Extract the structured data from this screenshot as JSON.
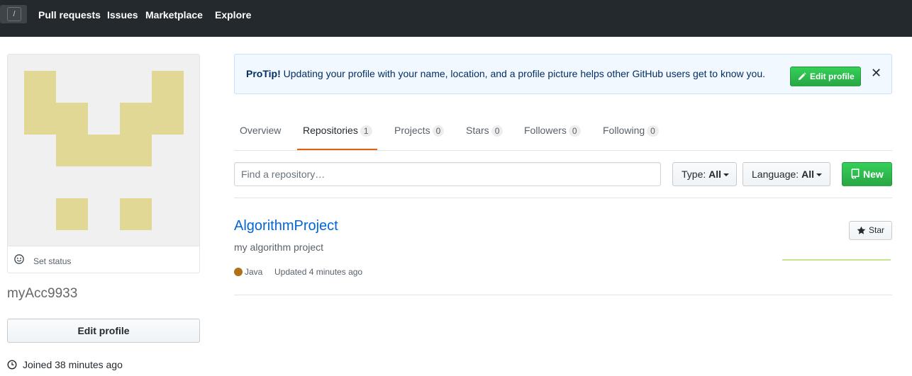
{
  "header": {
    "slash_key": "/",
    "nav": [
      "Pull requests",
      "Issues",
      "Marketplace",
      "Explore"
    ]
  },
  "profile": {
    "avatar_color": "#e1d896",
    "status_label": "Set status",
    "username": "myAcc9933",
    "edit_label": "Edit profile",
    "joined": "Joined 38 minutes ago"
  },
  "protip": {
    "bold": "ProTip!",
    "text": " Updating your profile with your name, location, and a profile picture helps other GitHub users get to know you.",
    "button": "Edit profile",
    "close": "✕"
  },
  "tabs": [
    {
      "label": "Overview",
      "count": ""
    },
    {
      "label": "Repositories",
      "count": "1"
    },
    {
      "label": "Projects",
      "count": "0"
    },
    {
      "label": "Stars",
      "count": "0"
    },
    {
      "label": "Followers",
      "count": "0"
    },
    {
      "label": "Following",
      "count": "0"
    }
  ],
  "filters": {
    "search_placeholder": "Find a repository…",
    "type_label": "Type:",
    "type_value": "All",
    "language_label": "Language:",
    "language_value": "All",
    "new_label": "New"
  },
  "repo": {
    "name": "AlgorithmProject",
    "description": "my algorithm project",
    "language": "Java",
    "language_color": "#b07219",
    "updated": "Updated 4 minutes ago",
    "star_label": "Star"
  }
}
